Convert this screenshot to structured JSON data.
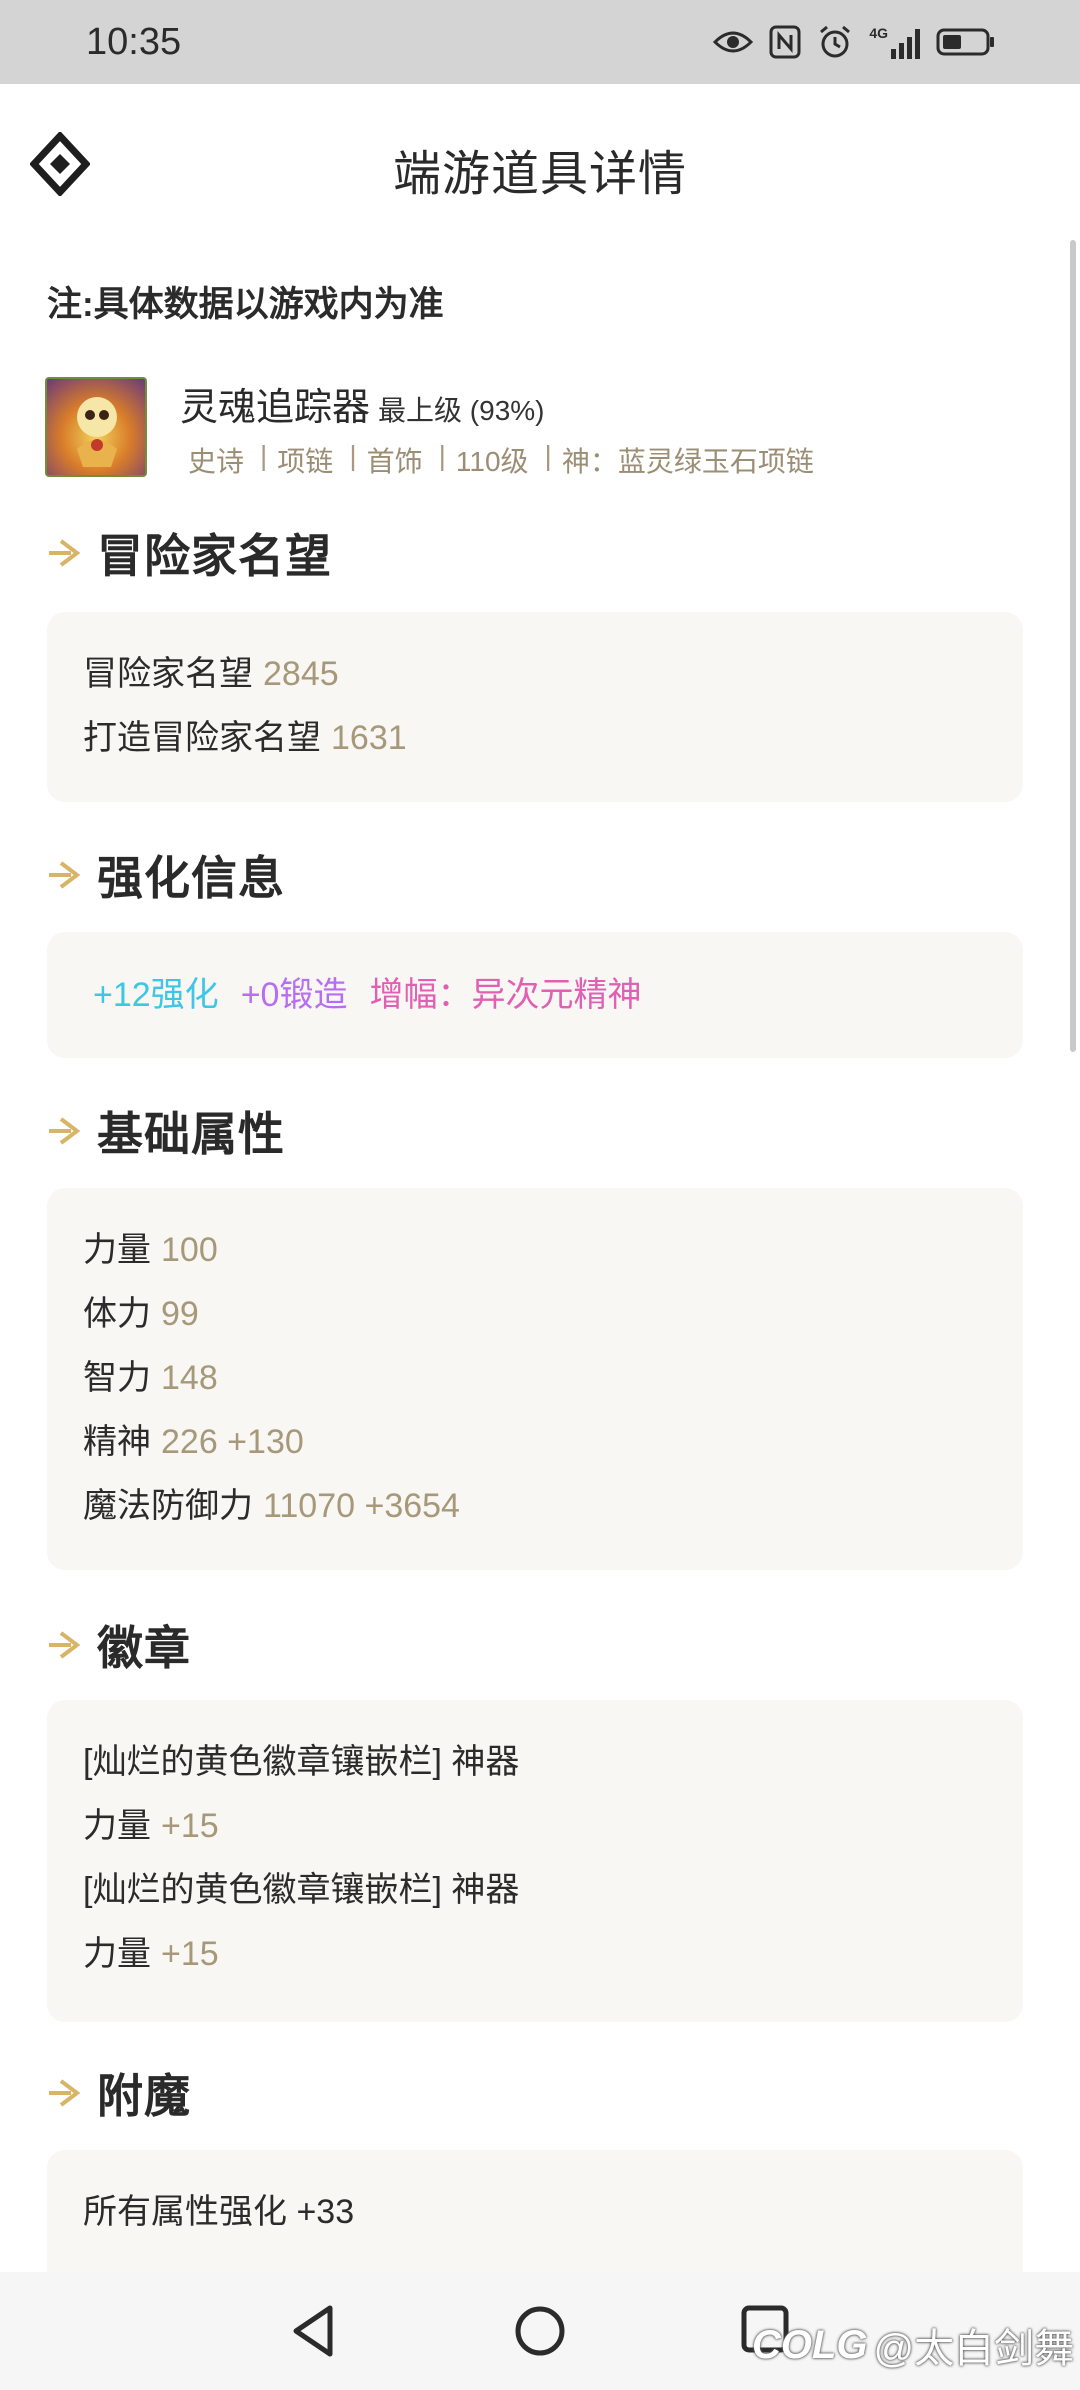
{
  "status_bar": {
    "time": "10:35",
    "icons": [
      "eye-icon",
      "nfc-icon",
      "alarm-icon",
      "signal-4g-icon",
      "battery-icon"
    ],
    "network_label_top": "4G",
    "battery_level": 0.4
  },
  "header": {
    "title": "端游道具详情",
    "logo_icon": "diamond-logo-icon"
  },
  "note": "注:具体数据以游戏内为准",
  "item": {
    "name": "灵魂追踪器",
    "grade": "最上级 (93%)",
    "tags": [
      "史诗",
      "项链",
      "首饰",
      "110级",
      "神：蓝灵绿玉石项链"
    ]
  },
  "sections": {
    "reputation": {
      "title": "冒险家名望",
      "rows": [
        {
          "label": "冒险家名望",
          "value": "2845"
        },
        {
          "label": "打造冒险家名望",
          "value": "1631"
        }
      ]
    },
    "enhance": {
      "title": "强化信息",
      "reinforce": "+12强化",
      "forge": "+0锻造",
      "amplify": "增幅：异次元精神"
    },
    "base": {
      "title": "基础属性",
      "rows": [
        {
          "label": "力量",
          "value": "100"
        },
        {
          "label": "体力",
          "value": "99"
        },
        {
          "label": "智力",
          "value": "148"
        },
        {
          "label": "精神",
          "value": "226 +130"
        },
        {
          "label": "魔法防御力",
          "value": "11070 +3654"
        }
      ]
    },
    "emblem": {
      "title": "徽章",
      "rows": [
        {
          "label": "[灿烂的黄色徽章镶嵌栏] 神器",
          "value": ""
        },
        {
          "label": "力量",
          "value": "+15"
        },
        {
          "label": "[灿烂的黄色徽章镶嵌栏] 神器",
          "value": ""
        },
        {
          "label": "力量",
          "value": "+15"
        }
      ]
    },
    "enchant": {
      "title": "附魔",
      "rows": [
        {
          "label": "所有属性强化 +33",
          "value": ""
        }
      ]
    }
  },
  "colors": {
    "accent_arrow": "#d8b466",
    "value_text": "#a7987a",
    "reinforce": "#3ec6e6",
    "forge": "#b86ef0",
    "amplify": "#e061b3"
  },
  "navbar": {
    "buttons": [
      "back-icon",
      "home-icon",
      "recents-icon"
    ]
  },
  "watermark": {
    "logo": "COLG",
    "text": "@太白剑舞"
  }
}
